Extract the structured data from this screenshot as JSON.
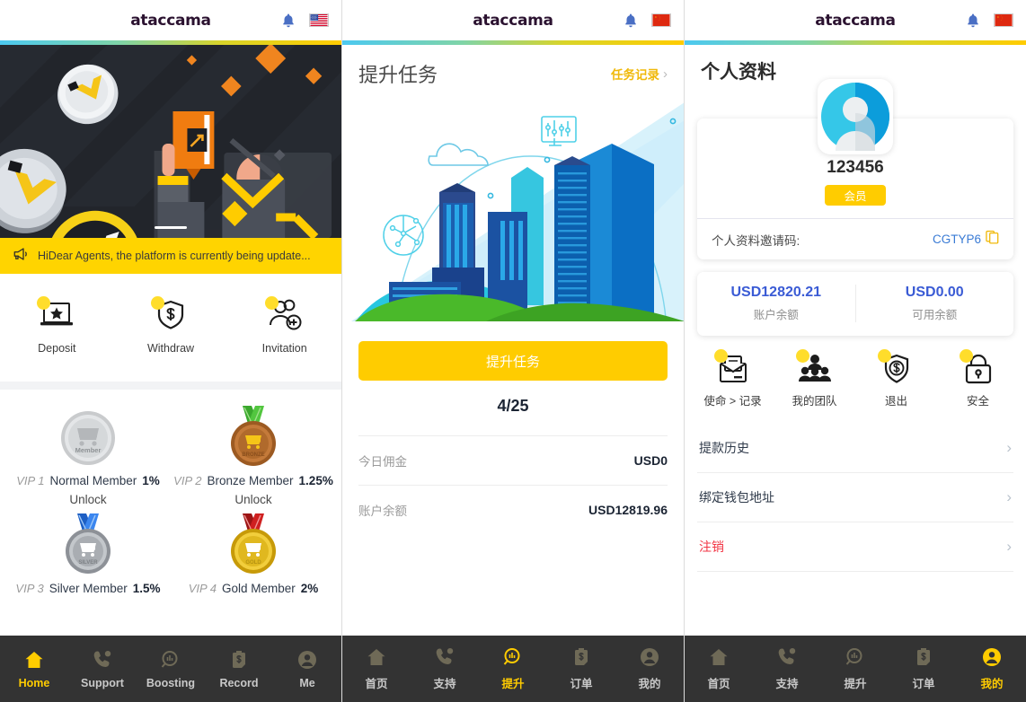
{
  "brand": "ataccama",
  "panel1": {
    "header": {
      "brand": "ataccama",
      "bell_icon": "bell-icon",
      "flag_icon": "flag-us-icon"
    },
    "notice": {
      "icon": "megaphone-icon",
      "text": "HiDear Agents, the platform is currently being update..."
    },
    "quick_actions": [
      {
        "icon": "deposit-icon",
        "label": "Deposit"
      },
      {
        "icon": "withdraw-icon",
        "label": "Withdraw"
      },
      {
        "icon": "invitation-icon",
        "label": "Invitation"
      }
    ],
    "vip_levels": [
      {
        "rank": "VIP 1",
        "name": "Normal Member",
        "rate": "1%",
        "action": "Unlock",
        "medal": "member-silver-coin"
      },
      {
        "rank": "VIP 2",
        "name": "Bronze Member",
        "rate": "1.25%",
        "action": "Unlock",
        "medal": "bronze-medal"
      },
      {
        "rank": "VIP 3",
        "name": "Silver Member",
        "rate": "1.5%",
        "action": "",
        "medal": "silver-medal"
      },
      {
        "rank": "VIP 4",
        "name": "Gold Member",
        "rate": "2%",
        "action": "",
        "medal": "gold-medal"
      }
    ],
    "tabs": [
      {
        "icon": "home-icon",
        "label": "Home",
        "active": true
      },
      {
        "icon": "support-icon",
        "label": "Support",
        "active": false
      },
      {
        "icon": "boosting-icon",
        "label": "Boosting",
        "active": false
      },
      {
        "icon": "record-icon",
        "label": "Record",
        "active": false
      },
      {
        "icon": "me-icon",
        "label": "Me",
        "active": false
      }
    ]
  },
  "panel2": {
    "header": {
      "brand": "ataccama",
      "bell_icon": "bell-icon",
      "flag_icon": "flag-cn-icon"
    },
    "title": "提升任务",
    "record_link": "任务记录",
    "boost_button": "提升任务",
    "progress": "4/25",
    "rows": [
      {
        "key": "今日佣金",
        "value": "USD0"
      },
      {
        "key": "账户余额",
        "value": "USD12819.96"
      }
    ],
    "tabs": [
      {
        "icon": "home-icon",
        "label": "首页",
        "active": false
      },
      {
        "icon": "support-icon",
        "label": "支持",
        "active": false
      },
      {
        "icon": "boosting-icon",
        "label": "提升",
        "active": true
      },
      {
        "icon": "record-icon",
        "label": "订单",
        "active": false
      },
      {
        "icon": "me-icon",
        "label": "我的",
        "active": false
      }
    ]
  },
  "panel3": {
    "header": {
      "brand": "ataccama",
      "bell_icon": "bell-icon",
      "flag_icon": "flag-cn-icon"
    },
    "title": "个人资料",
    "avatar_icon": "avatar-icon",
    "uid": "123456",
    "member_badge": "会员",
    "invite_label": "个人资料邀请码:",
    "invite_code": "CGTYP6",
    "copy_icon": "copy-icon",
    "balances": [
      {
        "value": "USD12820.21",
        "label": "账户余额"
      },
      {
        "value": "USD0.00",
        "label": "可用余额"
      }
    ],
    "functions": [
      {
        "icon": "mission-record-icon",
        "label": "使命 > 记录"
      },
      {
        "icon": "my-team-icon",
        "label": "我的团队"
      },
      {
        "icon": "logout-icon",
        "label": "退出"
      },
      {
        "icon": "security-icon",
        "label": "安全"
      }
    ],
    "menu": [
      {
        "label": "提款历史",
        "danger": false
      },
      {
        "label": "绑定钱包地址",
        "danger": false
      },
      {
        "label": "注销",
        "danger": true
      }
    ],
    "tabs": [
      {
        "icon": "home-icon",
        "label": "首页",
        "active": false
      },
      {
        "icon": "support-icon",
        "label": "支持",
        "active": false
      },
      {
        "icon": "boosting-icon",
        "label": "提升",
        "active": false
      },
      {
        "icon": "record-icon",
        "label": "订单",
        "active": false
      },
      {
        "icon": "me-icon",
        "label": "我的",
        "active": true
      }
    ]
  },
  "colors": {
    "accent_yellow": "#ffcc00",
    "link_blue": "#3a7bd5",
    "danger_red": "#f23645",
    "nav_bg": "#333333"
  }
}
